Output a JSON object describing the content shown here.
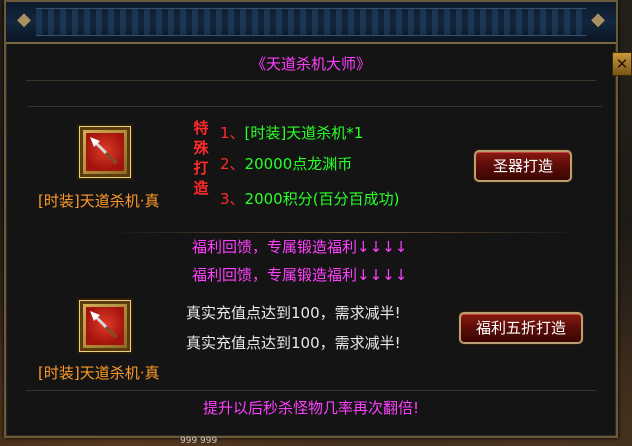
{
  "dialog": {
    "title": "《天道杀机大师》",
    "close_icon": "close-icon",
    "close_label": "✕"
  },
  "recipe_special": {
    "item_name": "[时装]天道杀机·真",
    "item_icon": "spear-icon",
    "label_chars": [
      "特",
      "殊",
      "打",
      "造"
    ],
    "requirements": [
      {
        "num": "1、",
        "text": "[时装]天道杀机*1"
      },
      {
        "num": "2、",
        "text": "20000点龙渊币"
      },
      {
        "num": "3、",
        "text": "2000积分(百分百成功)"
      }
    ],
    "button_label": "圣器打造"
  },
  "recipe_discount": {
    "promo_lines": [
      "福利回馈，专属锻造福利↓↓↓↓",
      "福利回馈，专属锻造福利↓↓↓↓"
    ],
    "notice_lines": [
      "真实充值点达到100，需求减半!",
      "真实充值点达到100，需求减半!"
    ],
    "item_name": "[时装]天道杀机·真",
    "item_icon": "spear-icon",
    "button_label": "福利五折打造"
  },
  "footer": {
    "text": "提升以后秒杀怪物几率再次翻倍!"
  },
  "bottom_strip": "999   999",
  "colors": {
    "title_magenta": "#ff40ff",
    "item_orange": "#ff9a2a",
    "requirement_green": "#2aff2a",
    "number_red": "#ff2a2a",
    "notice_white": "#e8e8e8"
  }
}
